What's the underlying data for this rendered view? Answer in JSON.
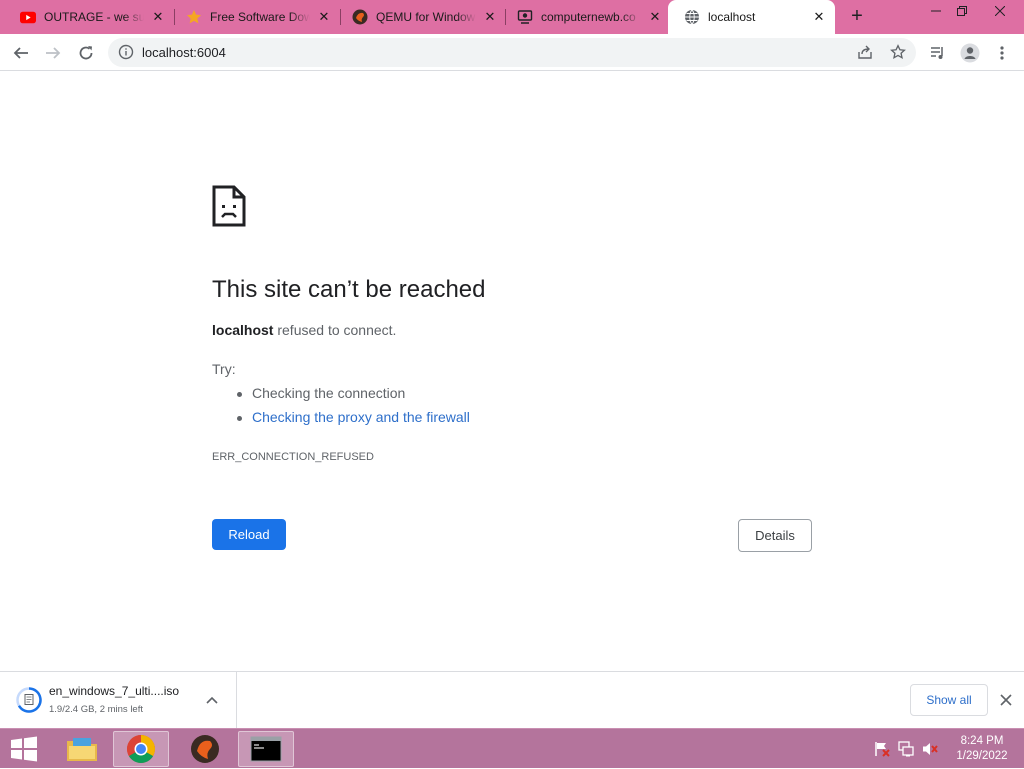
{
  "tabs": [
    {
      "title": "OUTRAGE - we suc",
      "favicon": "youtube-icon"
    },
    {
      "title": "Free Software Dow",
      "favicon": "star-icon"
    },
    {
      "title": "QEMU for Window",
      "favicon": "qemu-icon"
    },
    {
      "title": "computernewb.co",
      "favicon": "computernewb-icon"
    },
    {
      "title": "localhost",
      "favicon": "globe-icon",
      "active": true
    }
  ],
  "colors": {
    "tabstrip": "#de6fa3",
    "taskbar": "#b4749c",
    "reload": "#1a73e8",
    "link": "#2e6fca"
  },
  "toolbar": {
    "url": "localhost:6004"
  },
  "error": {
    "heading": "This site can’t be reached",
    "host": "localhost",
    "summary_rest": " refused to connect.",
    "try_label": "Try:",
    "suggestions": [
      "Checking the connection",
      "Checking the proxy and the firewall"
    ],
    "code": "ERR_CONNECTION_REFUSED",
    "reload_label": "Reload",
    "details_label": "Details"
  },
  "download": {
    "filename": "en_windows_7_ulti....iso",
    "status": "1.9/2.4 GB, 2 mins left",
    "show_all_label": "Show all"
  },
  "taskbar": {
    "time": "8:24 PM",
    "date": "1/29/2022"
  }
}
